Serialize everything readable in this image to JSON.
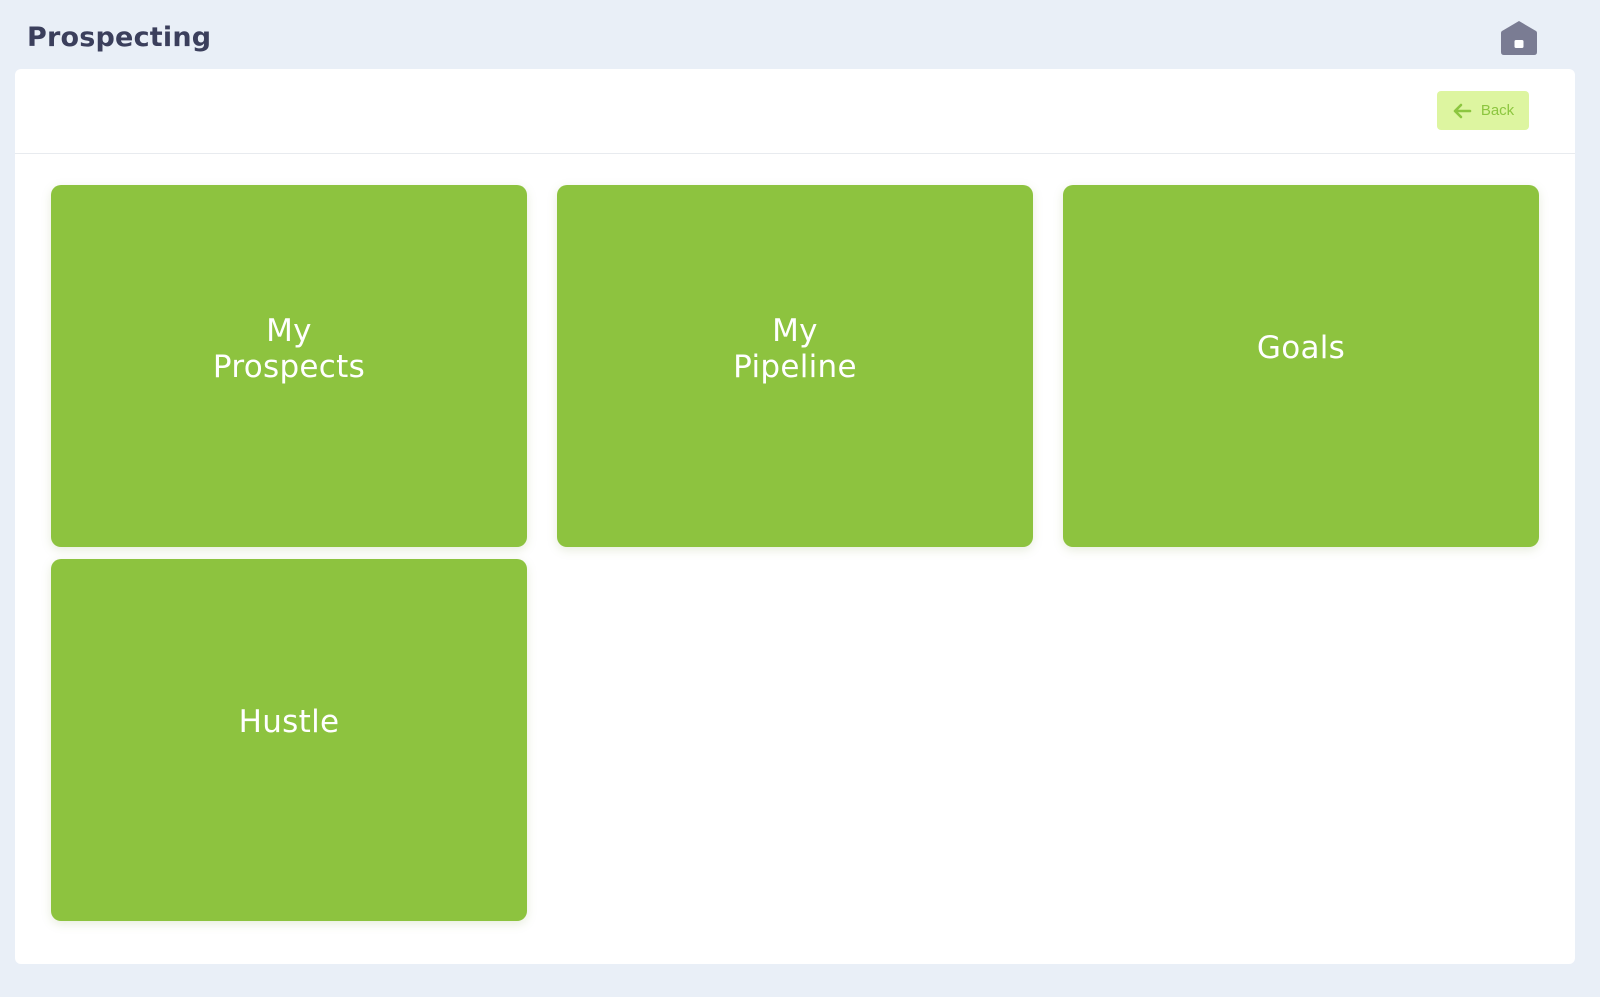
{
  "header": {
    "title": "Prospecting",
    "home_icon": "home-icon",
    "home_color": "#7a7c93"
  },
  "toolbar": {
    "back_label": "Back",
    "back_icon": "arrow-left-icon",
    "back_bg": "#ddf5a0",
    "back_color": "#8cc63f"
  },
  "tiles": [
    {
      "label": "My\nProspects"
    },
    {
      "label": "My\nPipeline"
    },
    {
      "label": "Goals"
    },
    {
      "label": "Hustle"
    }
  ],
  "colors": {
    "background": "#e9eff7",
    "panel": "#ffffff",
    "tile": "#8dc33f",
    "tile_text": "#ffffff"
  }
}
